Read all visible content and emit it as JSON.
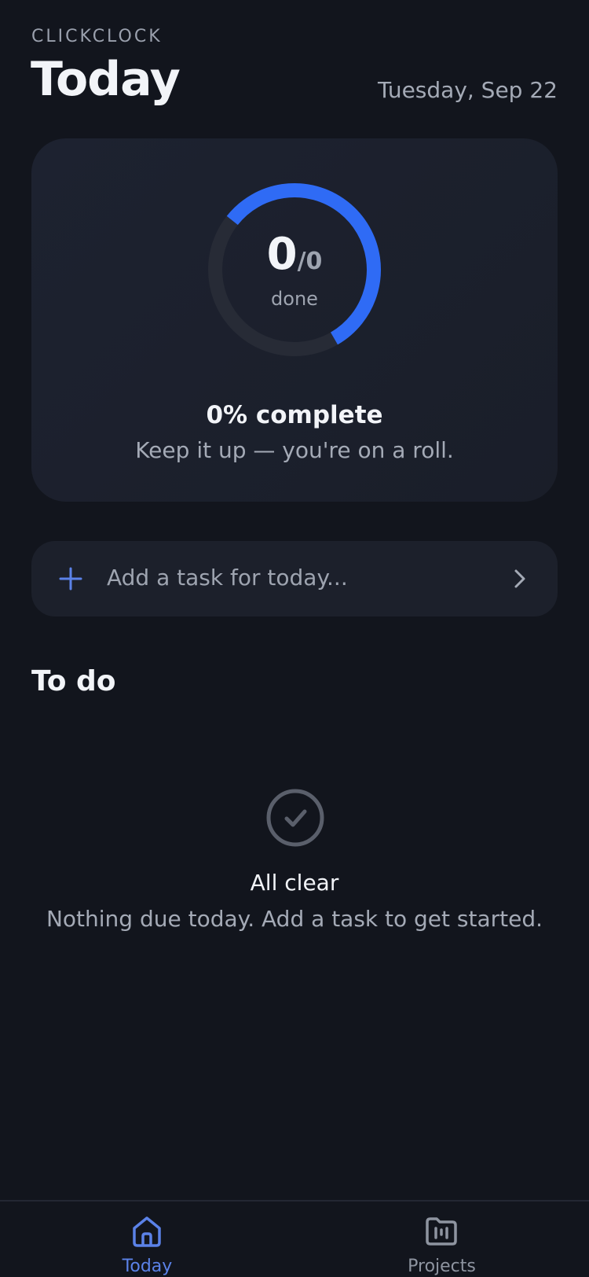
{
  "header": {
    "brand": "CLICKCLOCK",
    "title": "Today",
    "date": "Tuesday, Sep 22"
  },
  "progress": {
    "done": "0",
    "total": "/0",
    "done_label": "done",
    "percent_label": "0% complete",
    "encouragement": "Keep it up — you're on a roll.",
    "ring_fill_fraction": 0.56
  },
  "add_task": {
    "placeholder": "Add a task for today..."
  },
  "todo": {
    "section_title": "To do",
    "empty_title": "All clear",
    "empty_subtitle": "Nothing due today. Add a task to get started."
  },
  "nav": {
    "items": [
      {
        "label": "Today",
        "icon": "home-icon",
        "active": true
      },
      {
        "label": "Projects",
        "icon": "folder-icon",
        "active": false
      }
    ]
  },
  "colors": {
    "background": "#12151d",
    "card": "#1c202b",
    "accent": "#2f6bf5",
    "ring_track": "#272b36",
    "muted_text": "#a4aab6",
    "active_nav": "#5b82e8"
  }
}
